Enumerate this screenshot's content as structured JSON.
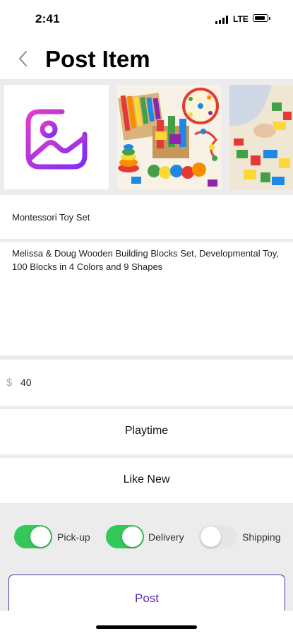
{
  "status_bar": {
    "time": "2:41",
    "network": "LTE"
  },
  "header": {
    "title": "Post Item"
  },
  "photos": {
    "add_icon": "add-photo-icon"
  },
  "item": {
    "name": "Montessori Toy Set",
    "description": "Melissa & Doug Wooden Building Blocks Set, Developmental Toy, 100 Blocks in 4 Colors and 9 Shapes",
    "currency_symbol": "$",
    "price": "40",
    "category": "Playtime",
    "condition": "Like New"
  },
  "options": [
    {
      "label": "Pick-up",
      "enabled": true
    },
    {
      "label": "Delivery",
      "enabled": true
    },
    {
      "label": "Shipping",
      "enabled": false
    }
  ],
  "post_button": {
    "label": "Post"
  },
  "colors": {
    "accent": "#5a2ba7",
    "toggle_on": "#34c759",
    "icon_gradient_start": "#e23cc8",
    "icon_gradient_end": "#7b2ff7"
  }
}
